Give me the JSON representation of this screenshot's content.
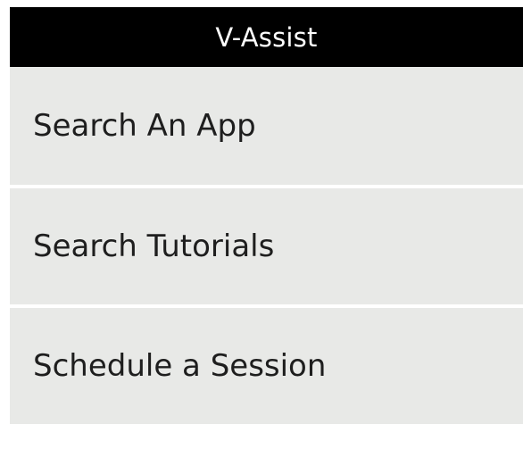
{
  "app": {
    "title": "V-Assist"
  },
  "menu": {
    "items": [
      {
        "label": "Search An App"
      },
      {
        "label": "Search Tutorials"
      },
      {
        "label": "Schedule a Session"
      }
    ]
  },
  "colors": {
    "title_bar_bg": "#000000",
    "title_text": "#ffffff",
    "menu_item_bg": "#e8e9e7",
    "menu_text": "#1e1e1e",
    "page_bg": "#ffffff"
  }
}
